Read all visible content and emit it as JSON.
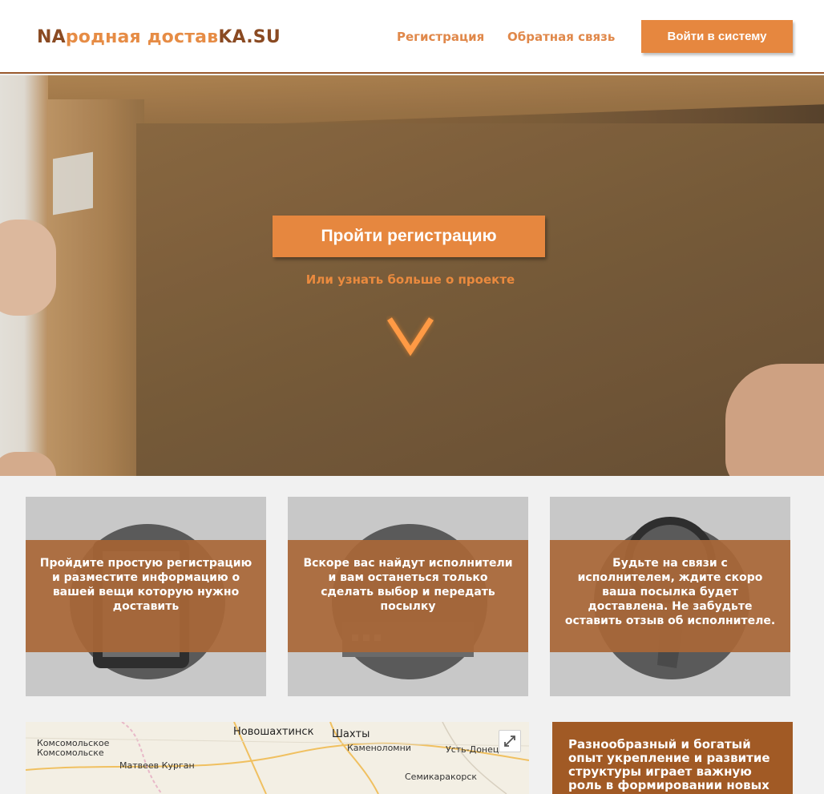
{
  "header": {
    "logo": {
      "part1": "NA",
      "part2": "родная достав",
      "part3": "KA.SU"
    },
    "nav": [
      {
        "label": "Регистрация"
      },
      {
        "label": "Обратная связь"
      }
    ],
    "login_label": "Войти в систему"
  },
  "hero": {
    "cta_label": "Пройти регистрацию",
    "learn_more": "Или узнать больше о проекте"
  },
  "features": [
    {
      "text": "Пройдите простую регистрацию и разместите информацию о вашей вещи которую нужно доставить",
      "icon": "tablet-icon"
    },
    {
      "text": "Вскоре вас найдут исполнители и вам останеться только сделать выбор и передать посылку",
      "icon": "handover-box-icon"
    },
    {
      "text": "Будьте на связи с исполнителем, ждите скоро ваша посылка будет доставлена. Не забудьте оставить отзыв об исполнителе.",
      "icon": "magnifier-icon"
    }
  ],
  "map": {
    "labels": [
      "Комсомольское",
      "Комсомольске",
      "Новошахтинск",
      "Шахты",
      "Каменоломни",
      "Усть-Донецкий",
      "Матвеев Курган",
      "Семикаракорск"
    ]
  },
  "info": {
    "text": "Разнообразный и богатый опыт укрепление и развитие структуры играет важную роль в формировании новых"
  },
  "colors": {
    "accent": "#e6873f",
    "brand_dark": "#8a4a22",
    "card_band": "#a96737",
    "info_bg": "#a15a25"
  }
}
